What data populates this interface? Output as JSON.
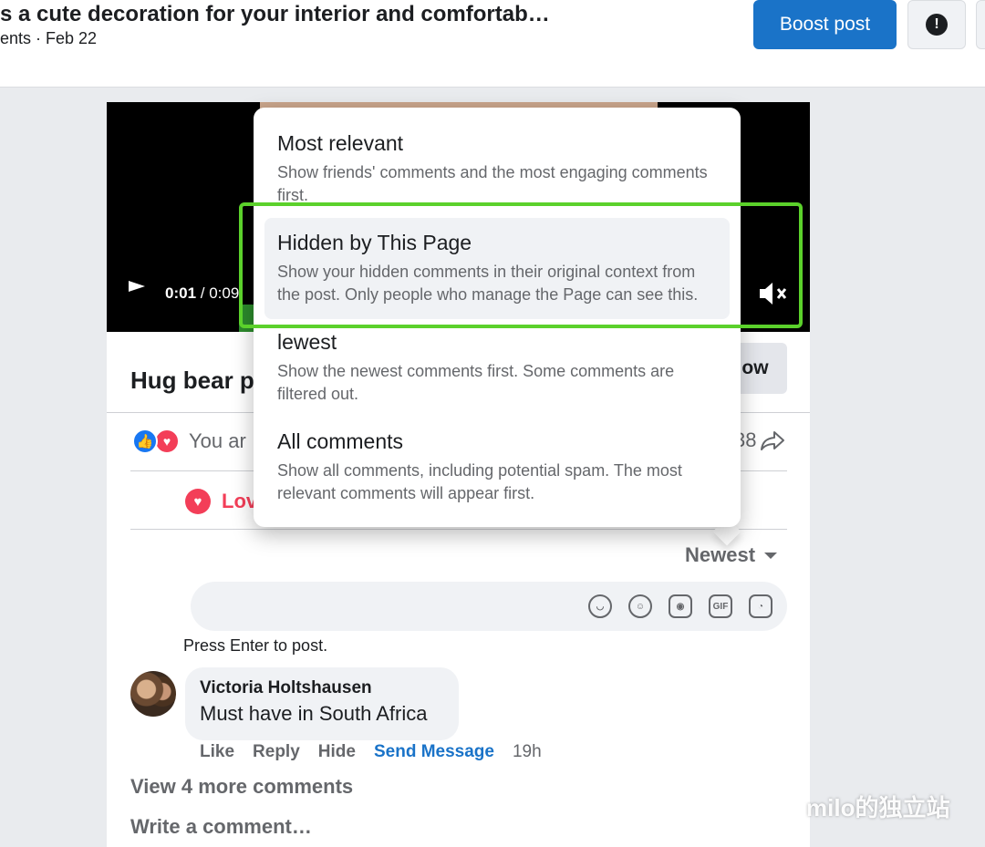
{
  "header": {
    "post_title": "s a cute decoration for your interior and comfortab…",
    "post_meta": "ents · Feb 22",
    "boost_label": "Boost post",
    "alert_glyph": "!"
  },
  "video": {
    "current_time": "0:01",
    "duration": " / 0:09"
  },
  "post": {
    "name": "Hug bear p",
    "follow_label": "ow",
    "reactions_text": "You ar",
    "shares_count": "38",
    "love_label": "Lov"
  },
  "sort": {
    "selected": "Newest",
    "options": [
      {
        "title": "Most relevant",
        "desc": "Show friends' comments and the most engaging comments first."
      },
      {
        "title": "Hidden by This Page",
        "desc": "Show your hidden comments in their original context from the post. Only people who manage the Page can see this."
      },
      {
        "title": "lewest",
        "desc": "Show the newest comments first. Some comments are filtered out."
      },
      {
        "title": "All comments",
        "desc": "Show all comments, including potential spam. The most relevant comments will appear first."
      }
    ]
  },
  "composer": {
    "hint": "Press Enter to post.",
    "gif_label": "GIF"
  },
  "comment": {
    "author": "Victoria Holtshausen",
    "text": "Must have in South Africa",
    "actions": {
      "like": "Like",
      "reply": "Reply",
      "hide": "Hide",
      "send": "Send Message",
      "time": "19h"
    }
  },
  "footer": {
    "view_more": "View 4 more comments",
    "write": "Write a comment…"
  },
  "watermark": "milo的独立站",
  "colors": {
    "accent": "#1a73c8",
    "love": "#f33e58",
    "highlight": "#5bd12b"
  }
}
